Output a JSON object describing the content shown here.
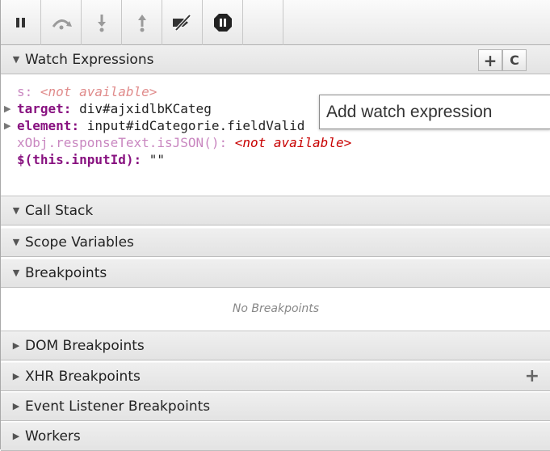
{
  "toolbar": {
    "buttons": [
      {
        "name": "pause-button",
        "icon": "pause-icon"
      },
      {
        "name": "step-over-button",
        "icon": "step-over-icon"
      },
      {
        "name": "step-into-button",
        "icon": "step-into-icon"
      },
      {
        "name": "step-out-button",
        "icon": "step-out-icon"
      },
      {
        "name": "deactivate-breakpoints-button",
        "icon": "deactivate-breakpoints-icon"
      },
      {
        "name": "pause-on-exceptions-button",
        "icon": "pause-on-exceptions-icon"
      }
    ]
  },
  "watch": {
    "title": "Watch Expressions",
    "add_glyph": "+",
    "refresh_glyph": "C",
    "expressions": [
      {
        "name": "s",
        "value": "<not available>",
        "expandable": false,
        "available": false
      },
      {
        "name": "target",
        "value": "div#ajxidlbKCateg",
        "expandable": true,
        "available": true
      },
      {
        "name": "element",
        "value": "input#idCategorie.fieldValid",
        "expandable": true,
        "available": true
      },
      {
        "name": "xObj.responseText.isJSON()",
        "value": "<not available>",
        "expandable": false,
        "available": false
      },
      {
        "name": "$(this.inputId)",
        "value": "\"\"",
        "expandable": false,
        "available": true
      }
    ],
    "tooltip": "Add watch expression"
  },
  "sections": {
    "call_stack": "Call Stack",
    "scope_variables": "Scope Variables",
    "breakpoints": "Breakpoints",
    "no_breakpoints": "No Breakpoints",
    "dom_breakpoints": "DOM Breakpoints",
    "xhr_breakpoints": "XHR Breakpoints",
    "xhr_add": "+",
    "event_listener_breakpoints": "Event Listener Breakpoints",
    "workers": "Workers"
  },
  "glyphs": {
    "expanded": "▼",
    "collapsed": "▶",
    "item_collapsed": "▶"
  },
  "colors": {
    "property_name": "#881280",
    "not_available": "#c80000"
  }
}
